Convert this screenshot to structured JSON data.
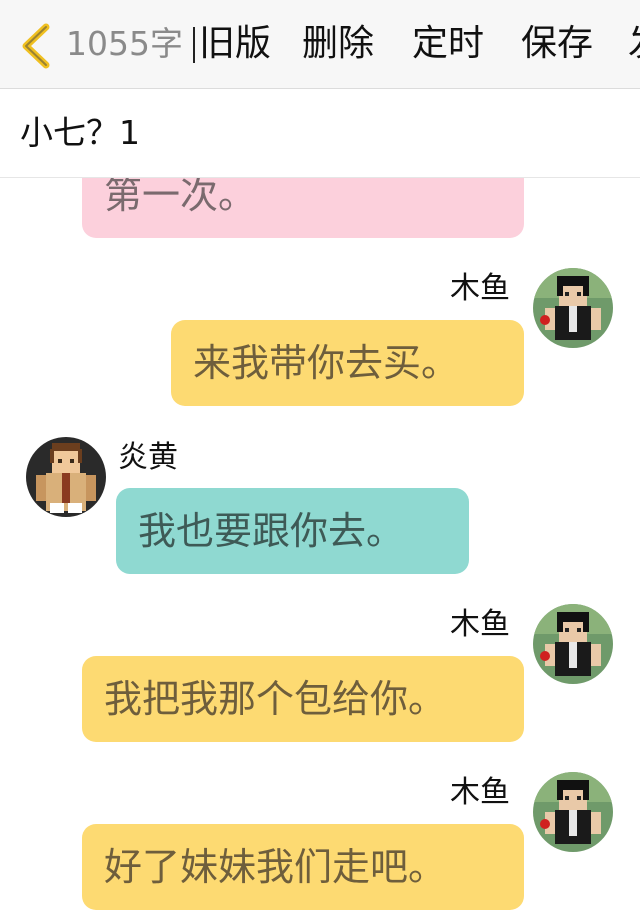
{
  "nav": {
    "word_count": "1055字",
    "buttons": [
      "旧版",
      "删除",
      "定时",
      "保存",
      "发"
    ]
  },
  "header": {
    "title": "小七？1"
  },
  "messages": [
    {
      "sender": "",
      "text": "第一次。",
      "side": "left",
      "color": "#fcd0dc"
    },
    {
      "sender": "木鱼",
      "text": "来我带你去买。",
      "side": "right",
      "color": "#fdda72",
      "avatar": "avatar-black-hair-icon"
    },
    {
      "sender": "炎黄",
      "text": "我也要跟你去。",
      "side": "left",
      "color": "#8fd9d1",
      "avatar": "avatar-brown-hair-icon"
    },
    {
      "sender": "木鱼",
      "text": "我把我那个包给你。",
      "side": "right",
      "color": "#fdda72",
      "avatar": "avatar-black-hair-icon"
    },
    {
      "sender": "木鱼",
      "text": "好了妹妹我们走吧。",
      "side": "right",
      "color": "#fdda72",
      "avatar": "avatar-black-hair-icon"
    }
  ],
  "colors": {
    "accent": "#f0c020",
    "pink": "#fcd0dc",
    "yellow": "#fdda72",
    "teal": "#8fd9d1"
  }
}
